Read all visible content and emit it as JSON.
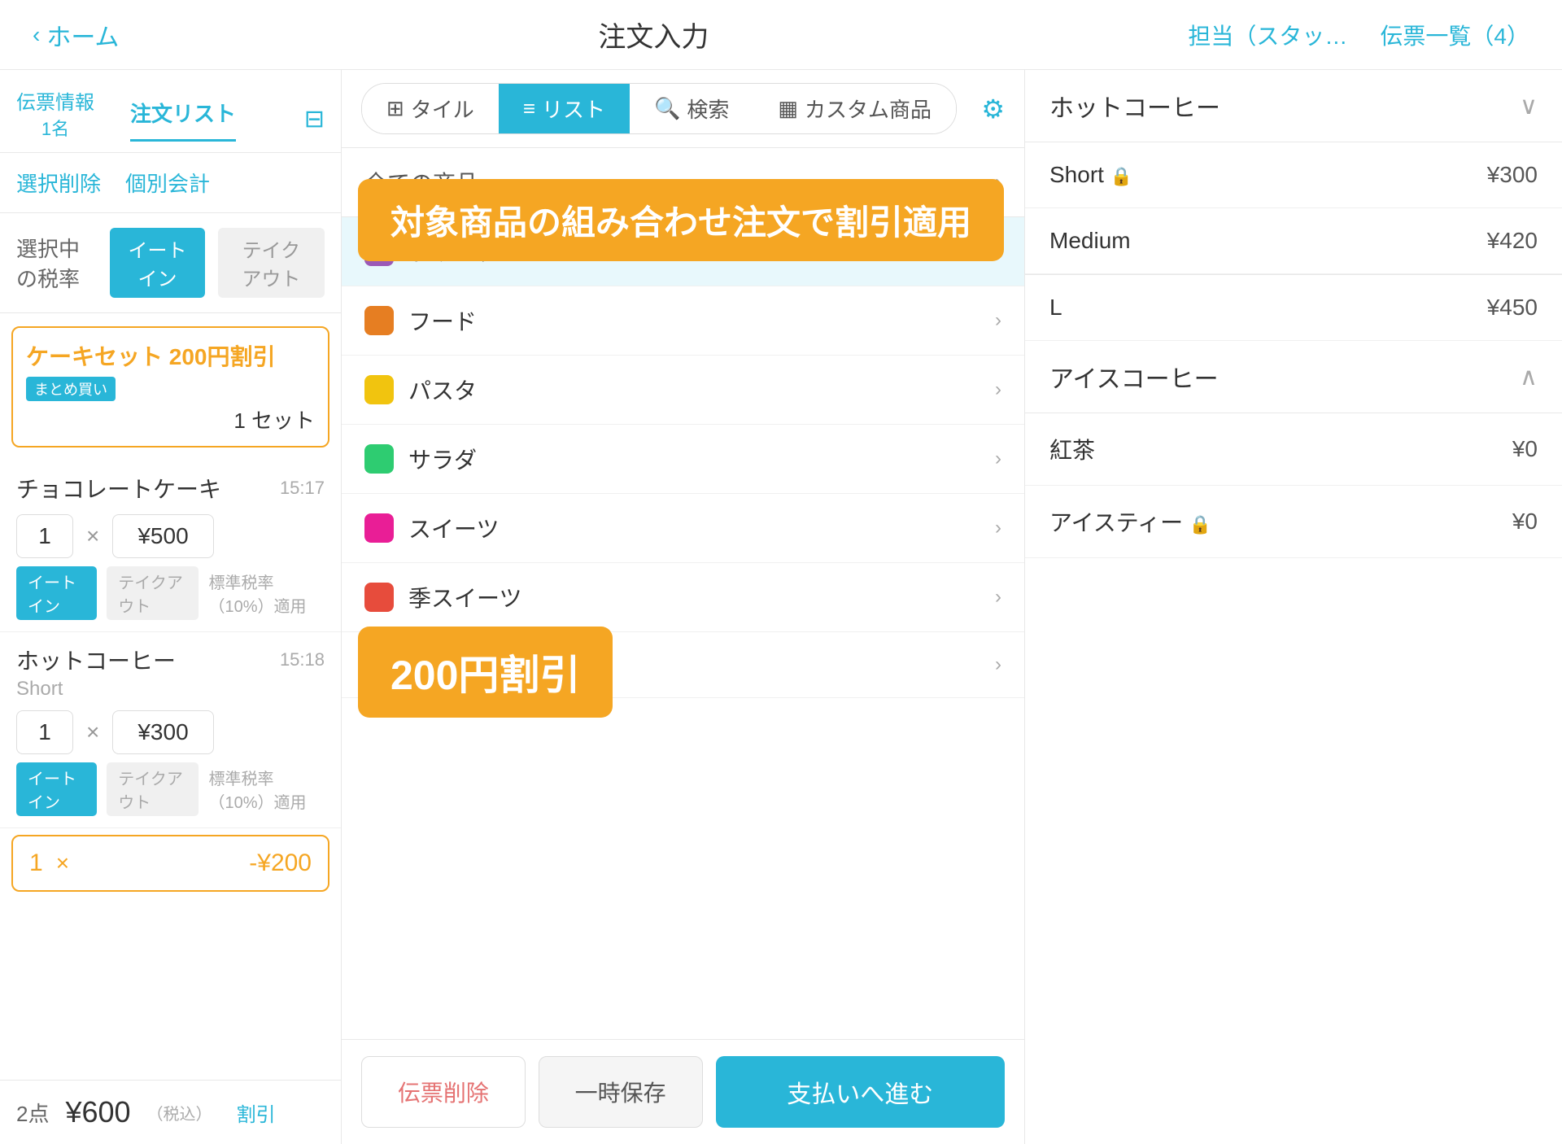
{
  "header": {
    "back_label": "ホーム",
    "title": "注文入力",
    "staff_label": "担当（スタッ…",
    "invoice_label": "伝票一覧（4）"
  },
  "left_panel": {
    "tab_info_label": "伝票情報",
    "tab_info_subtext": "1名",
    "tab_orders_label": "注文リスト",
    "action_delete": "選択削除",
    "action_split": "個別会計",
    "tax_label": "選択中の税率",
    "tax_eat_in": "イートイン",
    "tax_takeout": "テイクアウト",
    "discount_title": "ケーキセット 200円割引",
    "discount_badge": "まとめ買い",
    "discount_qty": "1 セット",
    "item1_name": "チョコレートケーキ",
    "item1_time": "15:17",
    "item1_qty": "1",
    "item1_price": "¥500",
    "item1_eat_in": "イートイン",
    "item1_takeout": "テイクアウト",
    "item1_tax": "標準税率（10%）適用",
    "item2_name": "ホットコーヒー",
    "item2_time": "15:18",
    "item2_sub": "Short",
    "item2_qty": "1",
    "item2_price": "¥300",
    "item2_eat_in": "イートイン",
    "item2_takeout": "テイクアウト",
    "item2_tax": "標準税率（10%）適用",
    "discount_row_qty": "1",
    "discount_row_price": "-¥200",
    "bottom_count": "2点",
    "bottom_total": "¥600",
    "bottom_tax_suffix": "（税込）",
    "bottom_discount": "割引"
  },
  "toolbar": {
    "tile_label": "タイル",
    "list_label": "リスト",
    "search_label": "検索",
    "custom_label": "カスタム商品"
  },
  "categories": {
    "all_label": "全ての商品",
    "items": [
      {
        "name": "ドリンク",
        "color": "#9b59b6"
      },
      {
        "name": "フード",
        "color": "#e67e22"
      },
      {
        "name": "パスタ",
        "color": "#f1c40f"
      },
      {
        "name": "サラダ",
        "color": "#2ecc71"
      },
      {
        "name": "スイーツ",
        "color": "#e91e96"
      },
      {
        "name": "季スイーツ",
        "color": "#e74c3c"
      },
      {
        "name": "",
        "color": "#b8860b"
      }
    ]
  },
  "right_panel": {
    "section1_title": "ホットコーヒー",
    "items_section1": [
      {
        "name": "Short",
        "price": "¥300",
        "lock": true
      },
      {
        "name": "Medium",
        "price": "¥420",
        "lock": false
      }
    ],
    "section2_title": "アイスコーヒー",
    "items_section2": [
      {
        "name": "L",
        "price": "¥450",
        "lock": false
      }
    ],
    "standalone_items": [
      {
        "name": "紅茶",
        "price": "¥0",
        "lock": false
      },
      {
        "name": "アイスティー",
        "price": "¥0",
        "lock": true
      }
    ]
  },
  "bottom_buttons": {
    "delete_label": "伝票削除",
    "save_label": "一時保存",
    "pay_label": "支払いへ進む"
  },
  "tooltips": {
    "top": "対象商品の組み合わせ注文で割引適用",
    "bottom": "200円割引"
  }
}
